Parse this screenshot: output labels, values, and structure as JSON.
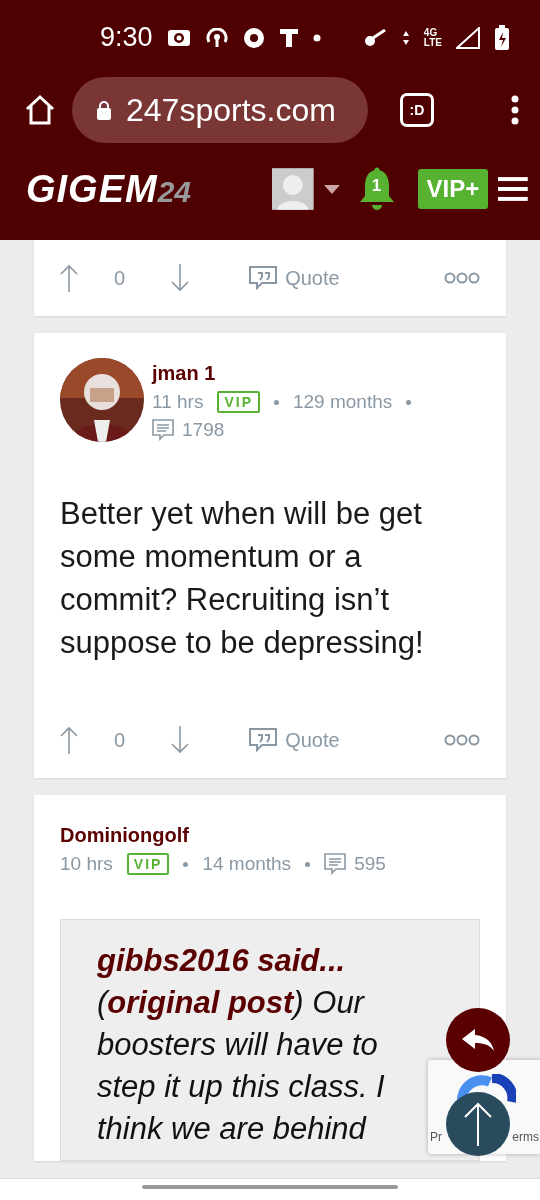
{
  "status_bar": {
    "time": "9:30",
    "network_top": "4G",
    "network_bottom": "LTE"
  },
  "browser": {
    "url": "247sports.com",
    "tab_switcher": ":D"
  },
  "site_header": {
    "logo_main": "GIGEM",
    "logo_suffix": "24",
    "notifications": "1",
    "vip_button": "VIP+"
  },
  "posts": [
    {
      "kind": "actions_only",
      "votes": "0",
      "quote_label": "Quote"
    },
    {
      "kind": "post",
      "author": "jman 1",
      "avatar": true,
      "time": "11 hrs",
      "badge": "VIP",
      "tenure": "129 months",
      "comments": "1798",
      "body": "Better yet when will be get some momentum or a commit? Recruiting isn’t suppose to be depressing!",
      "votes": "0",
      "quote_label": "Quote"
    },
    {
      "kind": "quoted",
      "author": "Dominiongolf",
      "avatar": false,
      "time": "10 hrs",
      "badge": "VIP",
      "tenure": "14 months",
      "comments": "595",
      "quote_lead": "gibbs2016 said...",
      "quote_text": "(**original post**) Our boosters will have to step it up this class. I think we are behind"
    }
  ],
  "recaptcha": {
    "left": "Pr",
    "right": "erms"
  }
}
